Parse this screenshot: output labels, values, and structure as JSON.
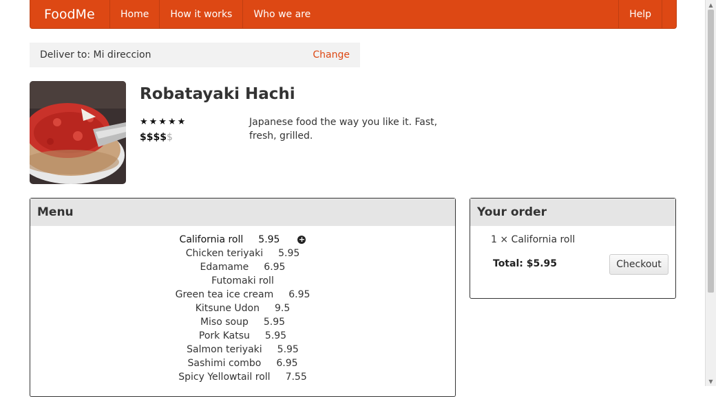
{
  "navbar": {
    "brand": "FoodMe",
    "items": [
      "Home",
      "How it works",
      "Who we are"
    ],
    "help": "Help"
  },
  "delivery": {
    "label": "Deliver to: Mi direccion",
    "change": "Change"
  },
  "restaurant": {
    "name": "Robatayaki Hachi",
    "rating_stars": "★★★★★",
    "price_active": "$$$$",
    "price_inactive": "$",
    "description": "Japanese food the way you like it. Fast, fresh, grilled."
  },
  "menu": {
    "title": "Menu",
    "items": [
      {
        "name": "California roll",
        "price": "5.95",
        "selected": true
      },
      {
        "name": "Chicken teriyaki",
        "price": "5.95"
      },
      {
        "name": "Edamame",
        "price": "6.95"
      },
      {
        "name": "Futomaki roll",
        "price": ""
      },
      {
        "name": "Green tea ice cream",
        "price": "6.95"
      },
      {
        "name": "Kitsune Udon",
        "price": "9.5"
      },
      {
        "name": "Miso soup",
        "price": "5.95"
      },
      {
        "name": "Pork Katsu",
        "price": "5.95"
      },
      {
        "name": "Salmon teriyaki",
        "price": "5.95"
      },
      {
        "name": "Sashimi combo",
        "price": "6.95"
      },
      {
        "name": "Spicy Yellowtail roll",
        "price": "7.55"
      }
    ]
  },
  "order": {
    "title": "Your order",
    "item": "1 × California roll",
    "total": "Total: $5.95",
    "checkout": "Checkout"
  },
  "colors": {
    "brand": "#dd4814",
    "panel_header": "#e5e5e5"
  }
}
